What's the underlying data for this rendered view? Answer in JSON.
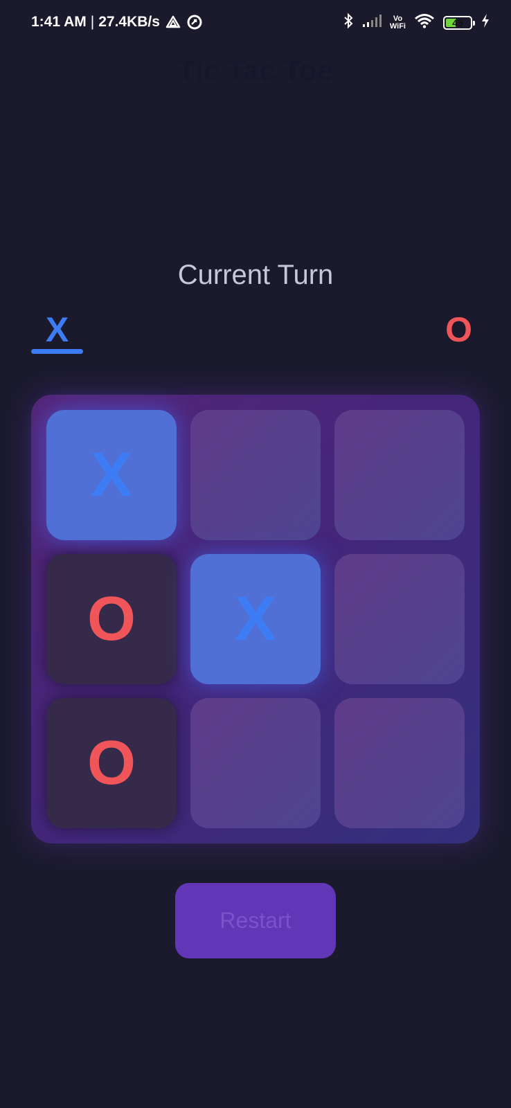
{
  "status_bar": {
    "time": "1:41 AM",
    "separator": "|",
    "speed": "27.4KB/s",
    "volte_top": "Vo",
    "volte_bottom": "WiFi",
    "battery_level": "45",
    "battery_fraction": 0.45,
    "icons": [
      "drive-triangle-icon",
      "circle-arrow-icon",
      "bluetooth-icon",
      "signal-icon",
      "wifi-icon",
      "battery-icon",
      "charging-bolt-icon"
    ]
  },
  "app": {
    "title": "Tic Tac Toe"
  },
  "turn": {
    "label": "Current Turn",
    "player_x": "X",
    "player_o": "O",
    "active": "X"
  },
  "board": {
    "cells": [
      "X",
      "",
      "",
      "O",
      "X",
      "",
      "O",
      "",
      ""
    ]
  },
  "restart": {
    "label": "Restart"
  },
  "colors": {
    "background": "#1b1a2d",
    "x_color": "#3d7cf5",
    "o_color": "#f0555a",
    "board_purple": "#4a2a7a",
    "restart_bg": "#6137b8"
  }
}
